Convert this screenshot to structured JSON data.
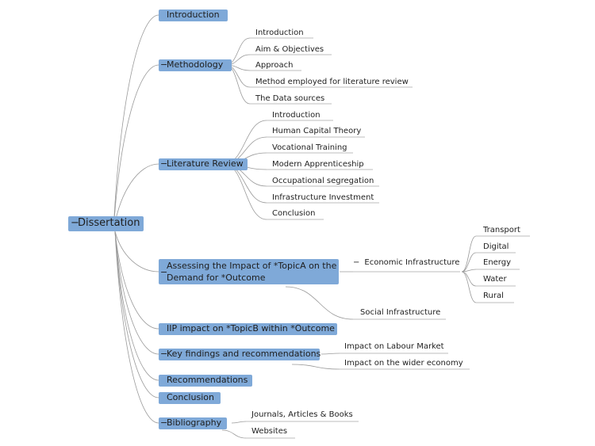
{
  "colors": {
    "node_fill": "#7fa9d8",
    "link": "#9a9a9a",
    "underline": "#a8a8a8"
  },
  "root": {
    "label": "Dissertation",
    "collapse_icon": "−"
  },
  "branches": [
    {
      "label": "Introduction",
      "children": []
    },
    {
      "label": "Methodology",
      "collapse_icon": "−",
      "children": [
        "Introduction",
        "Aim & Objectives",
        "Approach",
        "Method employed for literature review",
        "The Data sources"
      ]
    },
    {
      "label": "Literature Review",
      "collapse_icon": "−",
      "children": [
        "Introduction",
        "Human Capital Theory",
        "Vocational Training",
        "Modern Apprenticeship",
        "Occupational segregation",
        "Infrastructure Investment",
        "Conclusion"
      ]
    },
    {
      "label": "Assessing the Impact of *TopicA on the Demand for *Outcome",
      "collapse_icon": "−",
      "children": [
        {
          "label": "Economic Infrastructure",
          "collapse_icon": "−",
          "children": [
            "Transport",
            "Digital",
            "Energy",
            "Water",
            "Rural"
          ]
        },
        {
          "label": "Social Infrastructure"
        }
      ]
    },
    {
      "label": "IIP impact on *TopicB within *Outcome",
      "children": []
    },
    {
      "label": "Key findings and recommendations",
      "collapse_icon": "−",
      "children": [
        "Impact on Labour Market",
        "Impact on the wider economy"
      ]
    },
    {
      "label": "Recommendations",
      "children": []
    },
    {
      "label": "Conclusion",
      "children": []
    },
    {
      "label": "Bibliography",
      "collapse_icon": "−",
      "children": [
        "Journals, Articles & Books",
        "Websites"
      ]
    }
  ]
}
